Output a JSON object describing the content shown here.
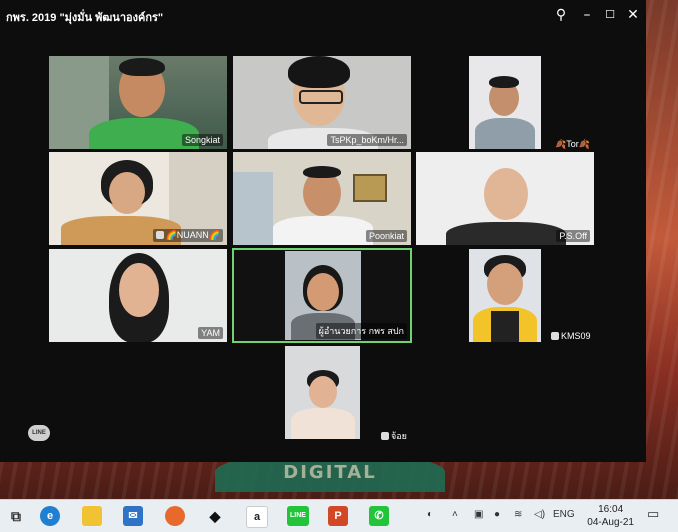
{
  "window": {
    "title": "กพร. 2019 \"มุ่งมั่น พัฒนาองค์กร\"",
    "controls": [
      "pin-icon",
      "minimize-icon",
      "maximize-icon",
      "close-icon"
    ]
  },
  "participants": [
    {
      "name": "Songkiat"
    },
    {
      "name": "TsPKp_boKm/Hr..."
    },
    {
      "name": "🍂Tor🍂"
    },
    {
      "name": "🌈NUANN🌈"
    },
    {
      "name": "Poonkiat"
    },
    {
      "name": "P.S.Off"
    },
    {
      "name": "YAM"
    },
    {
      "name": "ผู้อำนวยการ กพร สปก"
    },
    {
      "name": "KMS09"
    },
    {
      "name": "จ้อย"
    }
  ],
  "overlay": {
    "line_badge": "LINE"
  },
  "desktop": {
    "logo_text": "DIGITAL"
  },
  "taskbar": {
    "apps": [
      "task-view-icon",
      "edge-icon",
      "file-explorer-icon",
      "mail-icon",
      "firefox-icon",
      "dropbox-icon",
      "amazon-icon",
      "line-icon",
      "powerpoint-icon",
      "phone-icon"
    ],
    "app_letters": {
      "amazon": "a",
      "line": "LINE",
      "powerpoint": "P"
    },
    "tray": {
      "language": "ENG",
      "time": "16:04",
      "date": "04-Aug-21"
    }
  }
}
